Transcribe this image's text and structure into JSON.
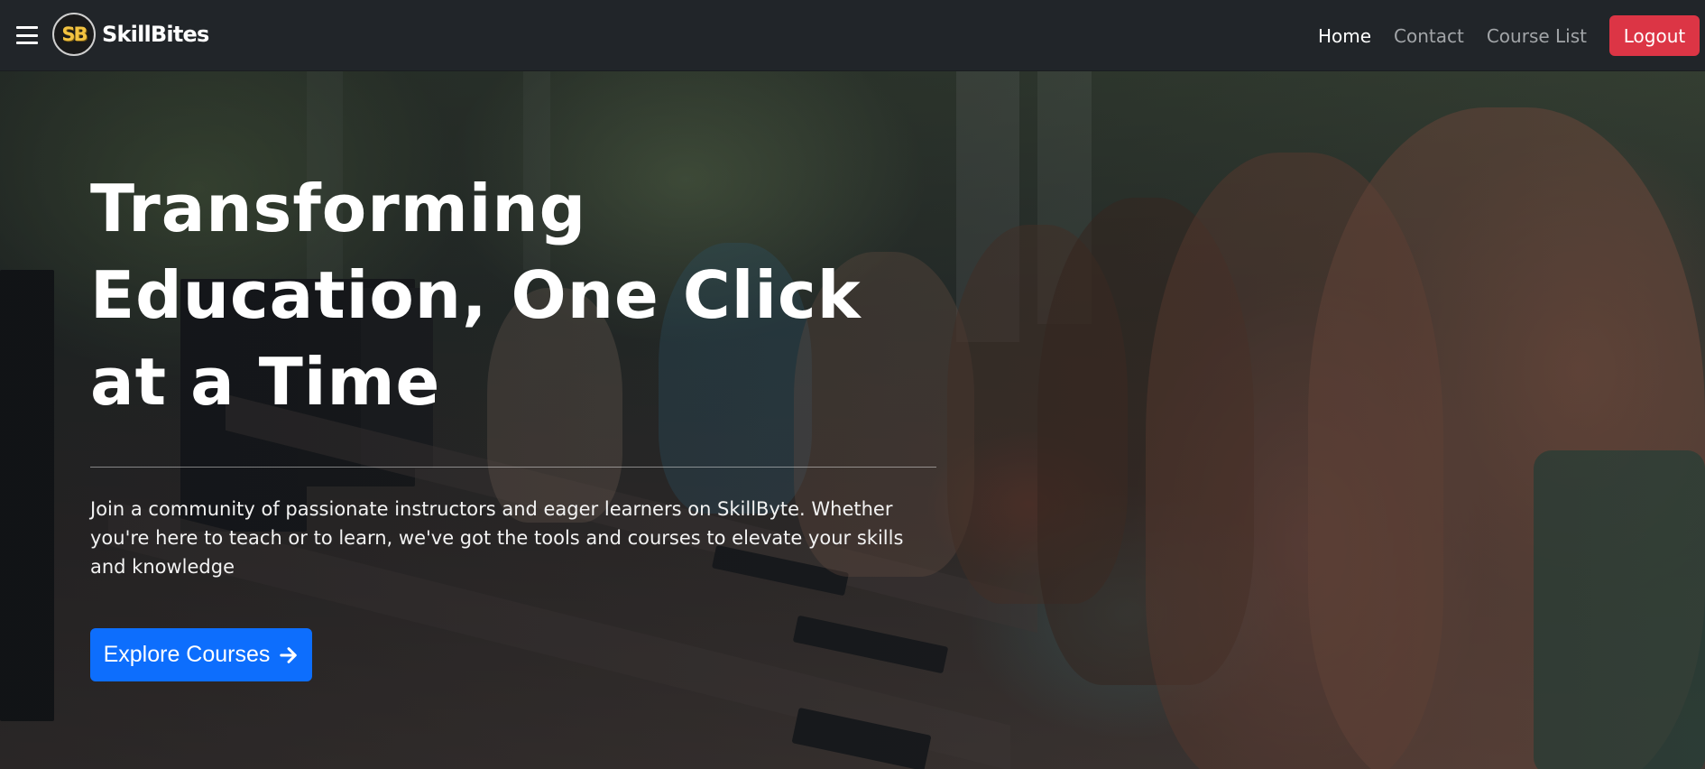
{
  "navbar": {
    "logo_mark": "SB",
    "brand": "SkillBites",
    "links": [
      {
        "label": "Home",
        "active": true
      },
      {
        "label": "Contact",
        "active": false
      },
      {
        "label": "Course List",
        "active": false
      }
    ],
    "logout_label": "Logout"
  },
  "hero": {
    "title": "Transforming Education, One Click at a Time",
    "text": "Join a community of passionate instructors and eager learners on SkillByte. Whether you're here to teach or to learn, we've got the tools and courses to elevate your skills and knowledge",
    "cta_label": "Explore Courses",
    "cta_icon": "arrow-right-icon"
  },
  "colors": {
    "navbar_bg": "#212529",
    "logout_bg": "#dc3545",
    "cta_bg": "#0d6efd",
    "logo_gold": "#f3c341"
  }
}
